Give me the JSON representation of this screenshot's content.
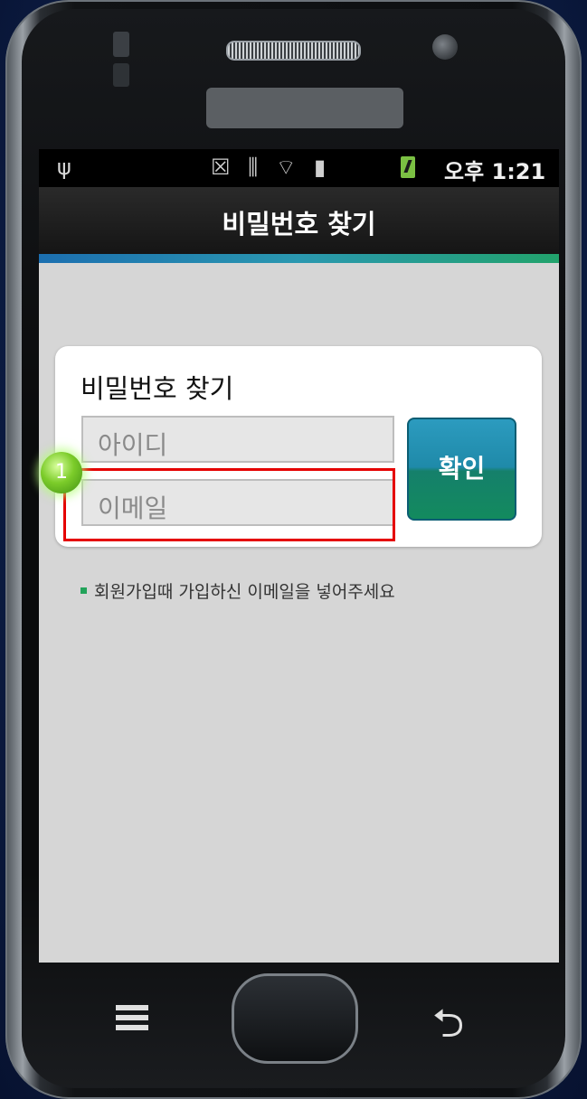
{
  "status_bar": {
    "usb_icon": "usb-icon",
    "notification_icons": "☒ ⫼ ⌔ ▮",
    "battery_icon": "battery-charging-icon",
    "time": "오후 1:21"
  },
  "header": {
    "title": "비밀번호 찾기"
  },
  "form": {
    "title": "비밀번호 찾기",
    "id_placeholder": "아이디",
    "email_placeholder": "이메일",
    "confirm_label": "확인"
  },
  "hint": "회원가입때 가입하신 이메일을 넣어주세요",
  "annotation": {
    "step": "1",
    "highlight_color": "#e50000"
  },
  "colors": {
    "accent": "#1f8aa9",
    "accent_green": "#22a35a"
  },
  "nav": {
    "menu_icon": "menu-icon",
    "home_icon": "home-icon",
    "back_icon": "back-icon",
    "back_glyph": "⮌"
  }
}
